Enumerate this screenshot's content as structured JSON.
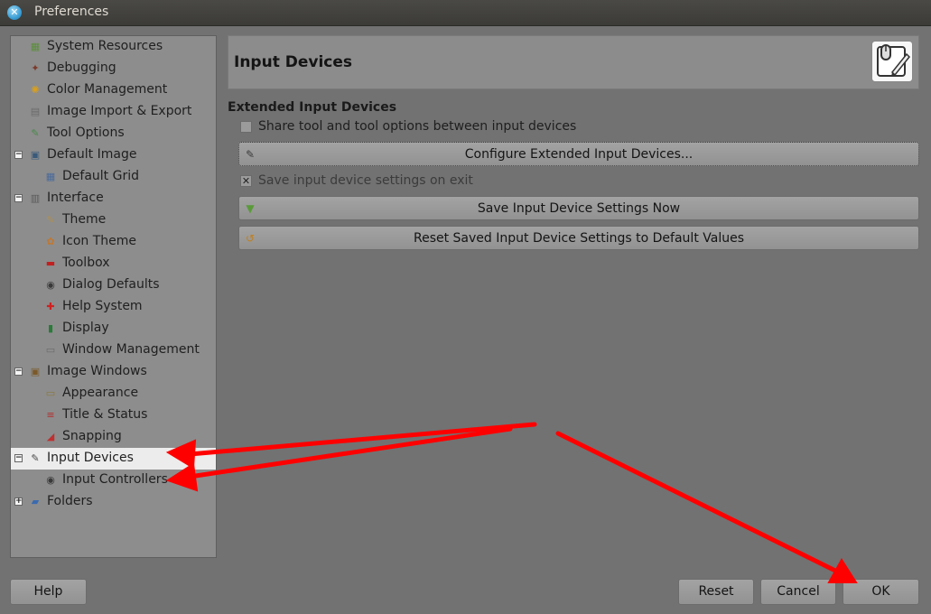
{
  "window": {
    "title": "Preferences",
    "close_symbol": "✕"
  },
  "sidebar": {
    "items": [
      {
        "label": "System Resources",
        "icon": "system-resources-icon",
        "glyph": "▦",
        "color": "#5b8f3a",
        "level": 0,
        "expander": ""
      },
      {
        "label": "Debugging",
        "icon": "debugging-icon",
        "glyph": "✦",
        "color": "#7a3a2a",
        "level": 0,
        "expander": ""
      },
      {
        "label": "Color Management",
        "icon": "color-management-icon",
        "glyph": "✺",
        "color": "#d8a020",
        "level": 0,
        "expander": ""
      },
      {
        "label": "Image Import & Export",
        "icon": "image-import-export-icon",
        "glyph": "▤",
        "color": "#6a6a6a",
        "level": 0,
        "expander": ""
      },
      {
        "label": "Tool Options",
        "icon": "tool-options-icon",
        "glyph": "✎",
        "color": "#4a8a4a",
        "level": 0,
        "expander": ""
      },
      {
        "label": "Default Image",
        "icon": "default-image-icon",
        "glyph": "▣",
        "color": "#3a5a7a",
        "level": 0,
        "expander": "−"
      },
      {
        "label": "Default Grid",
        "icon": "default-grid-icon",
        "glyph": "▦",
        "color": "#4a6a9a",
        "level": 1,
        "expander": ""
      },
      {
        "label": "Interface",
        "icon": "interface-icon",
        "glyph": "▥",
        "color": "#5a5a5a",
        "level": 0,
        "expander": "−"
      },
      {
        "label": "Theme",
        "icon": "theme-icon",
        "glyph": "✎",
        "color": "#b09050",
        "level": 1,
        "expander": ""
      },
      {
        "label": "Icon Theme",
        "icon": "icon-theme-icon",
        "glyph": "✿",
        "color": "#c07830",
        "level": 1,
        "expander": ""
      },
      {
        "label": "Toolbox",
        "icon": "toolbox-icon",
        "glyph": "▬",
        "color": "#c02020",
        "level": 1,
        "expander": ""
      },
      {
        "label": "Dialog Defaults",
        "icon": "dialog-defaults-icon",
        "glyph": "◉",
        "color": "#3a3a3a",
        "level": 1,
        "expander": ""
      },
      {
        "label": "Help System",
        "icon": "help-system-icon",
        "glyph": "✚",
        "color": "#d02020",
        "level": 1,
        "expander": ""
      },
      {
        "label": "Display",
        "icon": "display-icon",
        "glyph": "▮",
        "color": "#2a7a3a",
        "level": 1,
        "expander": ""
      },
      {
        "label": "Window Management",
        "icon": "window-management-icon",
        "glyph": "▭",
        "color": "#6a6a6a",
        "level": 1,
        "expander": ""
      },
      {
        "label": "Image Windows",
        "icon": "image-windows-icon",
        "glyph": "▣",
        "color": "#7a5a2a",
        "level": 0,
        "expander": "−"
      },
      {
        "label": "Appearance",
        "icon": "appearance-icon",
        "glyph": "▭",
        "color": "#8a7a3a",
        "level": 1,
        "expander": ""
      },
      {
        "label": "Title & Status",
        "icon": "title-status-icon",
        "glyph": "≡",
        "color": "#b03030",
        "level": 1,
        "expander": ""
      },
      {
        "label": "Snapping",
        "icon": "snapping-icon",
        "glyph": "◢",
        "color": "#c03030",
        "level": 1,
        "expander": ""
      },
      {
        "label": "Input Devices",
        "icon": "input-devices-icon",
        "glyph": "✎",
        "color": "#4a4a4a",
        "level": 0,
        "expander": "−",
        "selected": true
      },
      {
        "label": "Input Controllers",
        "icon": "input-controllers-icon",
        "glyph": "◉",
        "color": "#3a3a3a",
        "level": 1,
        "expander": ""
      },
      {
        "label": "Folders",
        "icon": "folders-icon",
        "glyph": "▰",
        "color": "#3a6ab0",
        "level": 0,
        "expander": "+"
      }
    ]
  },
  "main": {
    "header_title": "Input Devices",
    "header_icon": "input-devices-tablet-icon",
    "section_title": "Extended Input Devices",
    "share_checkbox": {
      "label": "Share tool and tool options between input devices",
      "checked": false,
      "mark": ""
    },
    "configure_button": {
      "label": "Configure Extended Input Devices...",
      "icon": "configure-icon",
      "glyph": "✎"
    },
    "save_on_exit_checkbox": {
      "label": "Save input device settings on exit",
      "checked": true,
      "mark": "✕"
    },
    "save_now_button": {
      "label": "Save Input Device Settings Now",
      "icon": "save-icon",
      "glyph": "▼"
    },
    "reset_saved_button": {
      "label": "Reset Saved Input Device Settings to Default Values",
      "icon": "reset-icon",
      "glyph": "↺"
    }
  },
  "footer": {
    "help_label": "Help",
    "reset_label": "Reset",
    "cancel_label": "Cancel",
    "ok_label": "OK"
  },
  "colors": {
    "arrow": "#ff0000",
    "background": "#727272",
    "selected_row": "#ececec"
  }
}
